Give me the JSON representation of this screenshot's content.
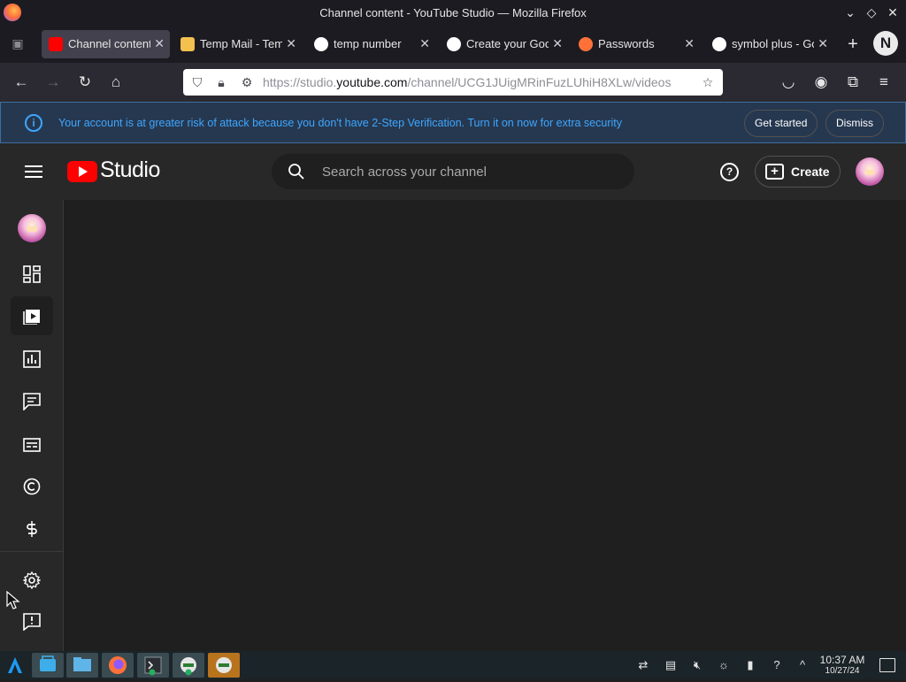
{
  "window": {
    "title": "Channel content - YouTube Studio — Mozilla Firefox"
  },
  "tabs": [
    {
      "label": "Channel content",
      "active": true,
      "favicon": "youtube-icon"
    },
    {
      "label": "Temp Mail - Temporary Email",
      "active": false,
      "favicon": "temp-mail-icon"
    },
    {
      "label": "temp number",
      "active": false,
      "favicon": "google-icon"
    },
    {
      "label": "Create your Google Account",
      "active": false,
      "favicon": "google-icon"
    },
    {
      "label": "Passwords",
      "active": false,
      "favicon": "firefox-icon"
    },
    {
      "label": "symbol plus - Google Search",
      "active": false,
      "favicon": "google-icon"
    }
  ],
  "urlbar": {
    "prefix": "https://studio.",
    "domain": "youtube.com",
    "suffix": "/channel/UCG1JUigMRinFuzLUhiH8XLw/videos"
  },
  "banner": {
    "message": "Your account is at greater risk of attack because you don't have 2-Step Verification. Turn it on now for extra security",
    "get_started": "Get started",
    "dismiss": "Dismiss"
  },
  "header": {
    "brand": "Studio",
    "search_placeholder": "Search across your channel",
    "create_label": "Create"
  },
  "sidebar": {
    "items": [
      {
        "name": "dashboard",
        "icon": "dashboard-icon"
      },
      {
        "name": "content",
        "icon": "content-icon",
        "active": true
      },
      {
        "name": "analytics",
        "icon": "analytics-icon"
      },
      {
        "name": "comments",
        "icon": "comments-icon"
      },
      {
        "name": "subtitles",
        "icon": "subtitles-icon"
      },
      {
        "name": "copyright",
        "icon": "copyright-icon"
      },
      {
        "name": "earn",
        "icon": "earn-icon"
      },
      {
        "name": "settings",
        "icon": "gear-icon"
      },
      {
        "name": "send-feedback",
        "icon": "feedback-icon"
      }
    ]
  },
  "taskbar": {
    "time": "10:37 AM",
    "date": "10/27/24"
  },
  "colors": {
    "brand_red": "#ff0000",
    "link_blue": "#3ea6ff",
    "bg": "#1f1f1f",
    "header_bg": "#282828"
  }
}
